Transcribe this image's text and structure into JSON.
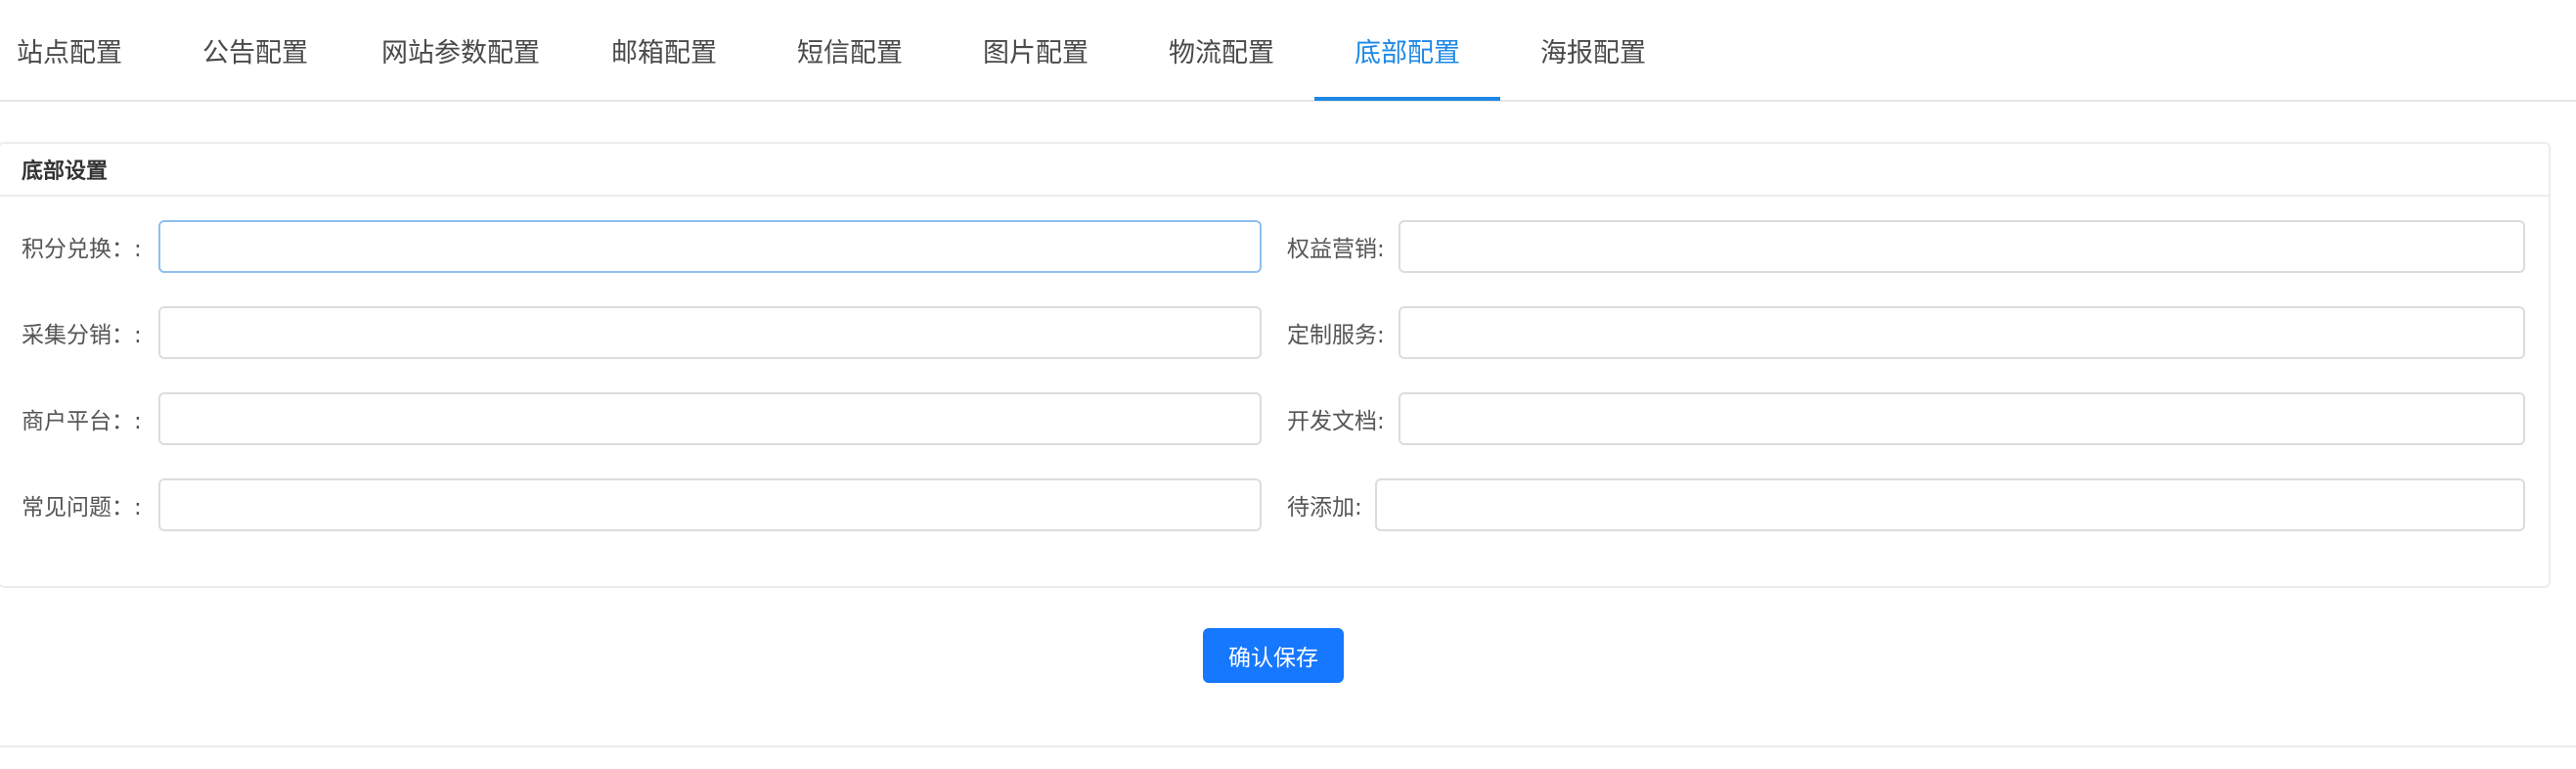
{
  "tabs": [
    {
      "label": "站点配置"
    },
    {
      "label": "公告配置"
    },
    {
      "label": "网站参数配置"
    },
    {
      "label": "邮箱配置"
    },
    {
      "label": "短信配置"
    },
    {
      "label": "图片配置"
    },
    {
      "label": "物流配置"
    },
    {
      "label": "底部配置",
      "active": true
    },
    {
      "label": "海报配置"
    }
  ],
  "panel": {
    "title": "底部设置",
    "left_fields": [
      {
        "label": "积分兑换：:",
        "value": ""
      },
      {
        "label": "采集分销：:",
        "value": ""
      },
      {
        "label": "商户平台：:",
        "value": ""
      },
      {
        "label": "常见问题：:",
        "value": ""
      }
    ],
    "right_fields": [
      {
        "label": "权益营销:",
        "value": ""
      },
      {
        "label": "定制服务:",
        "value": ""
      },
      {
        "label": "开发文档:",
        "value": ""
      },
      {
        "label": "待添加:",
        "value": ""
      }
    ]
  },
  "actions": {
    "save_label": "确认保存"
  },
  "colors": {
    "accent": "#1e88e5",
    "button": "#1677ff",
    "border": "#dcdcdc"
  }
}
